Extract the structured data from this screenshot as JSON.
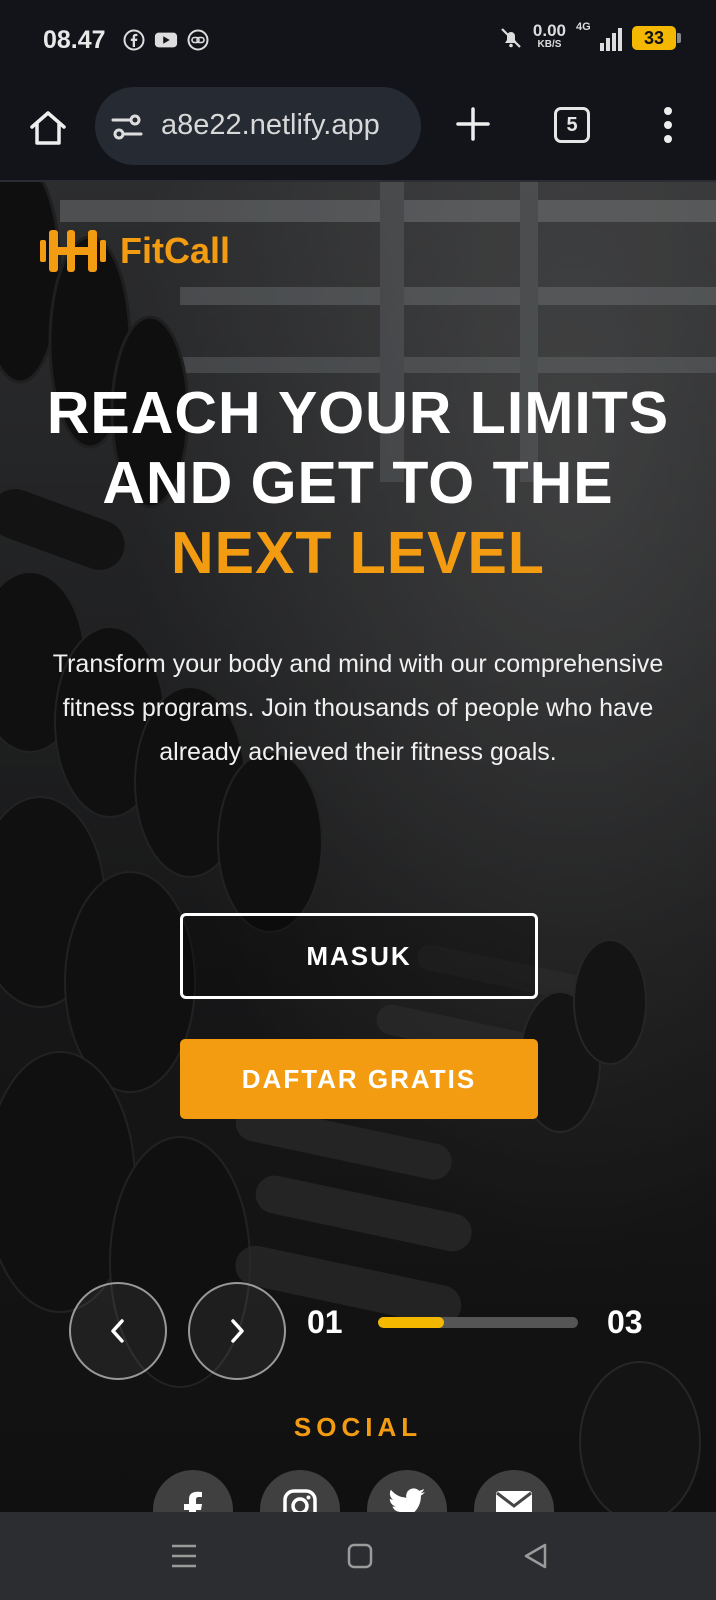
{
  "status_bar": {
    "time": "08.47",
    "icons_left": [
      "facebook-icon",
      "youtube-icon",
      "link-icon"
    ],
    "net_speed_value": "0.00",
    "net_speed_unit": "KB/S",
    "network": "4G",
    "battery": "33"
  },
  "browser": {
    "url": "a8e22.netlify.app",
    "tab_count": "5"
  },
  "hero": {
    "brand": "FitCall",
    "headline_line1": "REACH YOUR LIMITS",
    "headline_line2": "AND GET TO THE",
    "headline_accent": "NEXT LEVEL",
    "description": "Transform your body and mind with our comprehensive fitness programs. Join thousands of people who have already achieved their fitness goals.",
    "login_button": "MASUK",
    "register_button": "DAFTAR GRATIS",
    "slider": {
      "current": "01",
      "total": "03",
      "progress_fraction": 0.33
    },
    "social_title": "SOCIAL",
    "social_icons": [
      "facebook-icon",
      "instagram-icon",
      "twitter-icon",
      "mail-icon"
    ]
  },
  "colors": {
    "accent": "#f39c12",
    "progress": "#f5b800",
    "status_bar_bg": "#12141a",
    "nav_bar_bg": "#2c2d30"
  }
}
